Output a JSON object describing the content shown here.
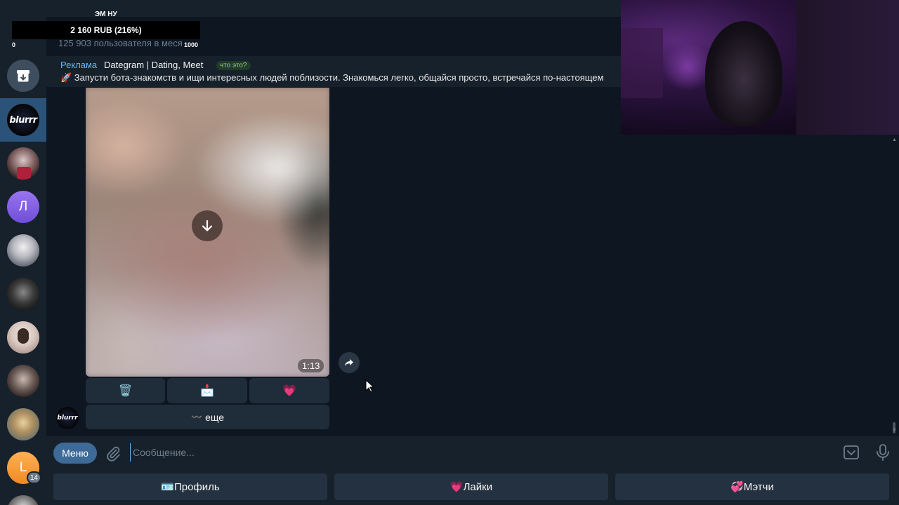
{
  "stream_overlay": {
    "name": "ЭМ НУ",
    "donation_goal": "2 160 RUB (216%)",
    "scale_min": "0",
    "scale_max": "1000"
  },
  "chat_header": {
    "members": "125 903 пользователя в меся"
  },
  "sponsored": {
    "label": "Реклама",
    "title": "Dategram | Dating, Meet",
    "what_is_this": "что это?",
    "text": "🚀 Запусти бота-знакомств и ищи интересных людей поблизости. Знакомься легко, общайся просто, встречайся по-настоящем"
  },
  "sidebar": {
    "items": [
      {
        "name": "archive",
        "icon": "archive-icon"
      },
      {
        "name": "blurrr",
        "label": "blurrr",
        "active": true
      },
      {
        "name": "chat-2"
      },
      {
        "name": "chat-3",
        "label": "Л"
      },
      {
        "name": "chat-4"
      },
      {
        "name": "chat-5"
      },
      {
        "name": "chat-6"
      },
      {
        "name": "chat-7"
      },
      {
        "name": "chat-8"
      },
      {
        "name": "chat-9",
        "label": "L",
        "badge": "14"
      }
    ]
  },
  "message": {
    "video_duration": "1:13",
    "sender_avatar": "blurrr",
    "inline_buttons": [
      {
        "label": "🗑️",
        "icon": "trash-icon"
      },
      {
        "label": "📩",
        "icon": "envelope-icon"
      },
      {
        "label": "💗",
        "icon": "heart-icon"
      }
    ],
    "more_button": "еще",
    "more_prefix": "〰️"
  },
  "composer": {
    "menu_label": "Меню",
    "placeholder": "Сообщение..."
  },
  "reply_keyboard": [
    {
      "label": "🪪Профиль"
    },
    {
      "label": "💗Лайки"
    },
    {
      "label": "💞Мэтчи"
    }
  ],
  "colors": {
    "background": "#0e1621",
    "panel": "#17212b",
    "accent": "#6ab3f3",
    "menu_button": "#3d6a97"
  }
}
